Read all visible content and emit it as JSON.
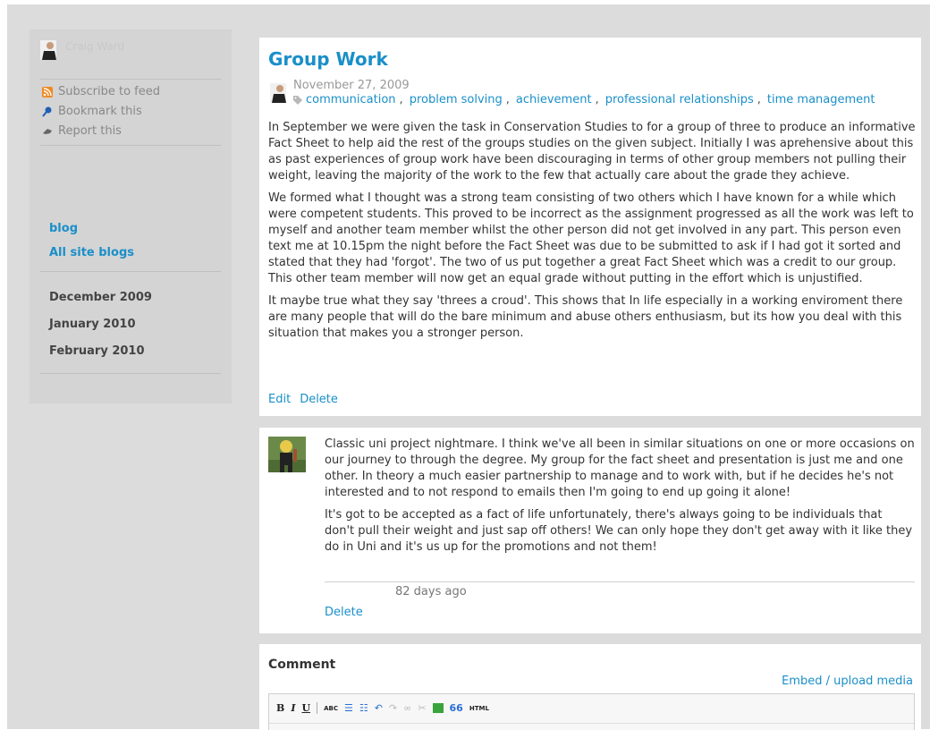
{
  "sidebar": {
    "owner_name": "Craig Ward",
    "actions": [
      {
        "label": "Subscribe to feed",
        "icon": "rss-icon"
      },
      {
        "label": "Bookmark this",
        "icon": "bookmark-pin-icon"
      },
      {
        "label": "Report this",
        "icon": "report-hand-icon"
      }
    ],
    "nav": [
      "blog",
      "All site blogs"
    ],
    "archives": [
      "December 2009",
      "January 2010",
      "February 2010"
    ]
  },
  "post": {
    "title": "Group Work",
    "date": "November 27, 2009",
    "tags": [
      "communication",
      "problem solving",
      "achievement",
      "professional relationships",
      "time management"
    ],
    "paragraphs": [
      "In September we were given the task in Conservation Studies to for a group of three to produce an informative Fact Sheet to help aid the rest of the groups studies on the given subject. Initially I was aprehensive about this as past experiences of group work have been discouraging in terms of other group members not pulling their weight, leaving the majority of the work to the few that actually care about the grade they achieve.",
      "We formed what I thought was a strong team consisting of two others which I have known for a while which were competent students. This proved to be incorrect as the assignment progressed as all the work was left to myself and another team member whilst the other person did not get involved in any part. This person even text me at 10.15pm the night before the Fact Sheet was due to be submitted to ask if I had got it sorted and stated that they had 'forgot'. The two of us put together a great Fact Sheet which was a credit to our group. This other team member will now get an equal grade without putting in the effort which is unjustified.",
      "It maybe true what they say 'threes a croud'. This shows that In life especially in a working enviroment there are many people that will do the bare minimum and abuse others enthusiasm, but its how you deal with this situation that makes you a stronger person."
    ],
    "actions": {
      "edit": "Edit",
      "delete": "Delete"
    }
  },
  "comment": {
    "paragraphs": [
      "Classic uni project nightmare. I think we've all been in similar situations on one or more occasions on our journey to through the degree. My group for the fact sheet and presentation is just me and one other. In theory a much easier partnership to manage and to work with, but if he decides he's not interested and to not respond to emails then I'm going to end up going it alone!",
      "It's got to be accepted as a fact of life unfortunately, there's always going to be individuals that don't pull their weight and just sap off others! We can only hope they don't get away with it like they do in Uni and it's us up for the promotions and not them!"
    ],
    "time": "82 days ago",
    "delete": "Delete"
  },
  "comment_form": {
    "heading": "Comment",
    "embed_link": "Embed / upload media",
    "toolbar": {
      "bold": "B",
      "italic": "I",
      "underline": "U",
      "spellcheck": "ABC",
      "blockquote": "66",
      "html": "HTML"
    }
  },
  "colors": {
    "link": "#1a8fc9",
    "sidebar_bg": "#d4d4d4",
    "frame_bg": "#dcdcdc"
  }
}
